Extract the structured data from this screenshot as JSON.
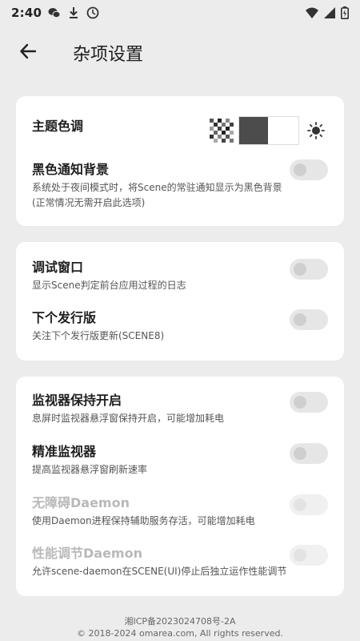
{
  "status_bar": {
    "time": "2:40",
    "left_icons": [
      "wechat-icon",
      "download-icon",
      "clock-icon"
    ],
    "right_icons": [
      "wifi-icon",
      "signal-icon",
      "battery-icon"
    ]
  },
  "app_bar": {
    "back_icon": "arrow-left-icon",
    "title": "杂项设置"
  },
  "theme": {
    "title": "主题色调",
    "swatches": [
      "pixel-pattern",
      "dark-light",
      "sun-icon"
    ]
  },
  "black_notification": {
    "title": "黑色通知背景",
    "desc_line1": "系统处于夜间模式时，将Scene的常驻通知显示为黑色背景",
    "desc_line2": "(正常情况无需开启此选项)",
    "enabled": false
  },
  "debug_window": {
    "title": "调试窗口",
    "desc": "显示Scene判定前台应用过程的日志",
    "enabled": false
  },
  "next_release": {
    "title": "下个发行版",
    "desc": "关注下个发行版更新(SCENE8)",
    "enabled": false
  },
  "monitor_keep": {
    "title": "监视器保持开启",
    "desc": "息屏时监视器悬浮窗保持开启，可能增加耗电",
    "enabled": false
  },
  "precise_monitor": {
    "title": "精准监视器",
    "desc": "提高监视器悬浮窗刷新速率",
    "enabled": false
  },
  "accessibility_daemon": {
    "title": "无障碍Daemon",
    "desc": "使用Daemon进程保持辅助服务存活，可能增加耗电",
    "enabled": false,
    "disabled": true
  },
  "perf_daemon": {
    "title": "性能调节Daemon",
    "desc": "允许scene-daemon在SCENE(UI)停止后独立运作性能调节",
    "enabled": false,
    "disabled": true
  },
  "footer": {
    "icp": "湘ICP备2023024708号-2A",
    "copyright": "© 2018-2024 omarea.com, All rights reserved."
  }
}
